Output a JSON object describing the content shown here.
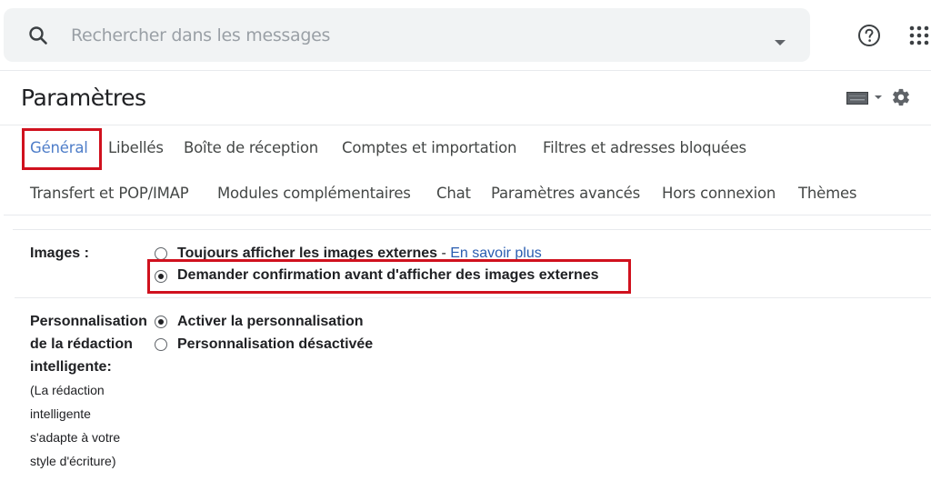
{
  "search": {
    "placeholder": "Rechercher dans les messages",
    "icon": "search-icon",
    "options_icon": "caret-down-icon"
  },
  "topbar": {
    "help_icon": "help-circle-icon",
    "apps_icon": "apps-grid-icon"
  },
  "header": {
    "title": "Paramètres",
    "input_tools_icon": "keyboard-icon",
    "settings_icon": "gear-icon"
  },
  "tabs": {
    "row1": [
      {
        "label": "Général",
        "active": true
      },
      {
        "label": "Libellés"
      },
      {
        "label": "Boîte de réception"
      },
      {
        "label": "Comptes et importation"
      },
      {
        "label": "Filtres et adresses bloquées"
      }
    ],
    "row2": [
      {
        "label": "Transfert et POP/IMAP"
      },
      {
        "label": "Modules complémentaires"
      },
      {
        "label": "Chat"
      },
      {
        "label": "Paramètres avancés"
      },
      {
        "label": "Hors connexion"
      },
      {
        "label": "Thèmes"
      }
    ]
  },
  "settings": {
    "images": {
      "label": "Images :",
      "options": [
        {
          "label": "Toujours afficher les images externes",
          "checked": false
        },
        {
          "label": "Demander confirmation avant d'afficher des images externes",
          "checked": true
        }
      ],
      "separator": " - ",
      "learn_more": "En savoir plus"
    },
    "smart_compose_personalization": {
      "label_lines": [
        "Personnalisation",
        "de la rédaction",
        "intelligente:"
      ],
      "help_lines": [
        "(La rédaction",
        "intelligente",
        "s'adapte à votre",
        "style d'écriture)"
      ],
      "options": [
        {
          "label": "Activer la personnalisation",
          "checked": true
        },
        {
          "label": "Personnalisation désactivée",
          "checked": false
        }
      ]
    }
  },
  "colors": {
    "highlight": "#d0111e",
    "active_tab": "#4f7ec9",
    "link": "#2a5db0",
    "search_bg": "#f1f3f4"
  }
}
